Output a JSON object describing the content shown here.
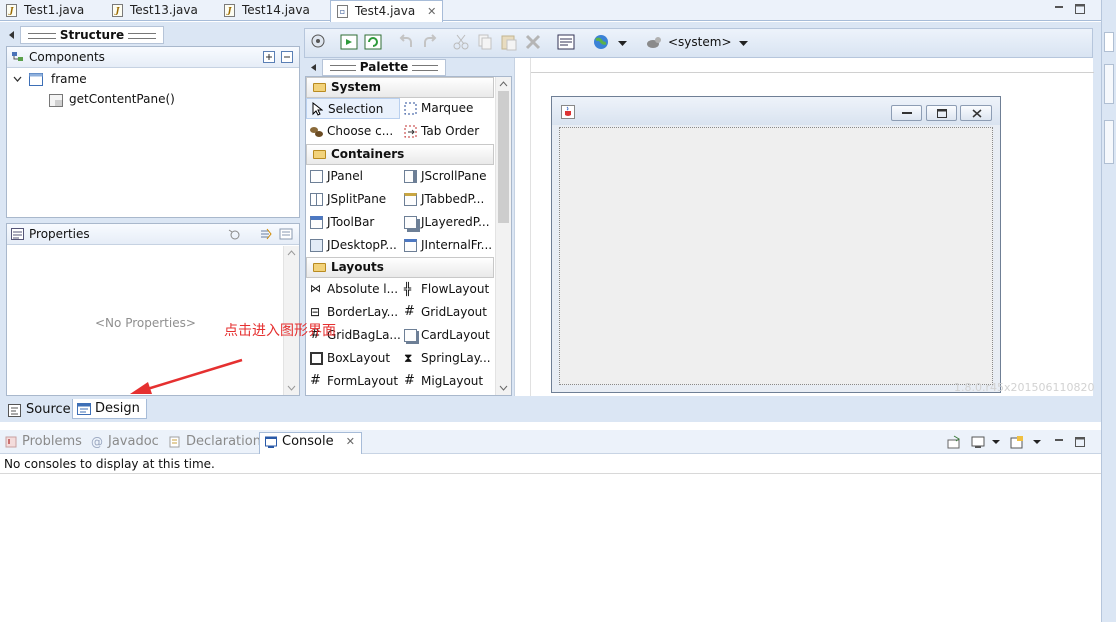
{
  "editor_tabs": [
    {
      "label": "Test1.java",
      "active": false
    },
    {
      "label": "Test13.java",
      "active": false
    },
    {
      "label": "Test14.java",
      "active": false
    },
    {
      "label": "Test4.java",
      "active": true
    }
  ],
  "structure": {
    "title": "Structure",
    "components_label": "Components",
    "tree": [
      {
        "label": "frame"
      },
      {
        "label": "getContentPane()"
      }
    ]
  },
  "properties": {
    "title": "Properties",
    "empty_text": "<No Properties>"
  },
  "palette": {
    "title": "Palette",
    "categories": [
      {
        "label": "System",
        "items": [
          "Selection",
          "Marquee",
          "Choose c...",
          "Tab Order"
        ]
      },
      {
        "label": "Containers",
        "items": [
          "JPanel",
          "JScrollPane",
          "JSplitPane",
          "JTabbedP...",
          "JToolBar",
          "JLayeredP...",
          "JDesktopP...",
          "JInternalFr..."
        ]
      },
      {
        "label": "Layouts",
        "items": [
          "Absolute l...",
          "FlowLayout",
          "BorderLay...",
          "GridLayout",
          "GridBagLa...",
          "CardLayout",
          "BoxLayout",
          "SpringLay...",
          "FormLayout",
          "MigLayout"
        ]
      }
    ]
  },
  "toolbar": {
    "system_label": "<system>"
  },
  "annotation": {
    "text": "点击进入图形界面",
    "color": "#e53030"
  },
  "version_watermark": "1.8.0.r45x201506110820",
  "bottom_tabs": [
    {
      "label": "Source",
      "active": false
    },
    {
      "label": "Design",
      "active": true
    }
  ],
  "console_tabs": [
    {
      "label": "Problems",
      "active": false
    },
    {
      "label": "Javadoc",
      "active": false
    },
    {
      "label": "Declaration",
      "active": false
    },
    {
      "label": "Console",
      "active": true
    }
  ],
  "console": {
    "message": "No consoles to display at this time."
  }
}
